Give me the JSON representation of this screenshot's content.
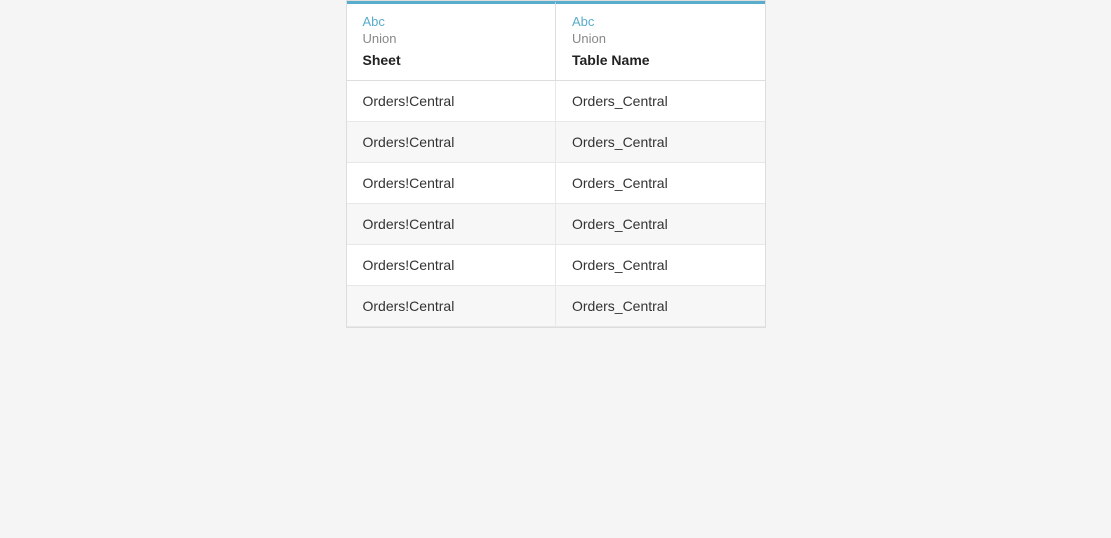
{
  "table": {
    "columns": [
      {
        "type_label": "Abc",
        "subtype_label": "Union",
        "column_name": "Sheet"
      },
      {
        "type_label": "Abc",
        "subtype_label": "Union",
        "column_name": "Table Name"
      }
    ],
    "rows": [
      {
        "sheet": "Orders!Central",
        "table_name": "Orders_Central"
      },
      {
        "sheet": "Orders!Central",
        "table_name": "Orders_Central"
      },
      {
        "sheet": "Orders!Central",
        "table_name": "Orders_Central"
      },
      {
        "sheet": "Orders!Central",
        "table_name": "Orders_Central"
      },
      {
        "sheet": "Orders!Central",
        "table_name": "Orders_Central"
      },
      {
        "sheet": "Orders!Central",
        "table_name": "Orders_Central"
      }
    ]
  }
}
